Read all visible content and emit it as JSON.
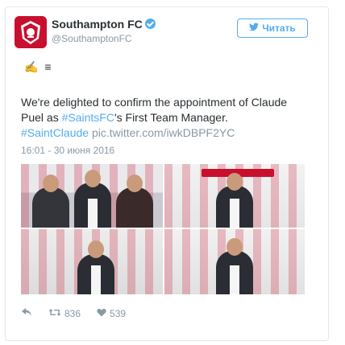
{
  "account": {
    "name": "Southampton FC",
    "handle": "@SouthamptonFC"
  },
  "follow": {
    "label": "Читать",
    "icon": "twitter-bird-icon"
  },
  "tweet": {
    "emoji": "✍ ≡",
    "text_part1": "We're delighted to confirm the appointment of Claude Puel as ",
    "hashtag1": "#SaintsFC",
    "text_part2": "'s First Team Manager.",
    "hashtag2": "#SaintClaude",
    "link": "pic.twitter.com/iwkDBPF2YC",
    "timestamp": "16:01 - 30 июня 2016"
  },
  "actions": {
    "reply_icon": "reply-icon",
    "retweet_icon": "retweet-icon",
    "retweet_count": "836",
    "like_icon": "heart-icon",
    "like_count": "539"
  },
  "colors": {
    "accent": "#55acee",
    "brand": "#c8102e",
    "text": "#292f33",
    "muted": "#8899a6"
  }
}
